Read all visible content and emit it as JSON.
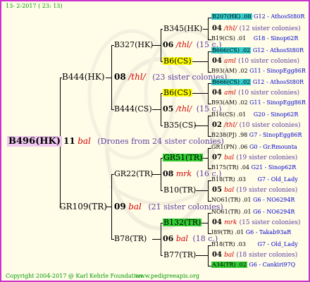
{
  "header": {
    "date": "13-  2-2017 ( 23: 13)"
  },
  "footer": {
    "copyright": "Copyright 2004-2017 @ Karl Kehrle Foundation.",
    "website": "www.pedigreeapis.org"
  },
  "root": {
    "id": "B496(HK)",
    "drones_num": "11",
    "drones_group": "bal",
    "drones_note": "(Drones from 24 sister colonies)"
  },
  "gen1": [
    "B444(HK)",
    "GR109(TR)"
  ],
  "gen1_drones": [
    {
      "num": "08",
      "group": "/thl/",
      "note": "(23 sister colonies)"
    },
    {
      "num": "09",
      "group": "bal",
      "note": "(21 sister colonies)"
    }
  ],
  "gen2": [
    "B327(HK)",
    "B444(CS)",
    "GR22(TR)",
    "B78(TR)"
  ],
  "gen2_drones": [
    {
      "num": "06",
      "group": "/thl/",
      "note": "(15 c.)"
    },
    {
      "num": "05",
      "group": "/thl/",
      "note": "(15 c.)"
    },
    {
      "num": "08",
      "group": "mrk",
      "note": "(16 c.)"
    },
    {
      "num": "06",
      "group": "bal",
      "note": "(18 c.)"
    }
  ],
  "gen3": [
    "B345(HK)",
    "B6(CS)",
    "B6(CS)",
    "B35(CS)",
    "GR51(TR)",
    "B10(TR)",
    "B132(TR)",
    "B77(TR)"
  ],
  "gen3_drones": [
    {
      "num": "04",
      "group": "/thl/",
      "note": "(12 sister colonies)"
    },
    {
      "num": "04",
      "group": "aml",
      "note": "(10 sister colonies)"
    },
    {
      "num": "04",
      "group": "aml",
      "note": "(10 sister colonies)"
    },
    {
      "num": "02",
      "group": "/thl/",
      "note": "(10 sister colonies)"
    },
    {
      "num": "07",
      "group": "bal",
      "note": "(19 sister colonies)"
    },
    {
      "num": "05",
      "group": "bal",
      "note": "(19 sister colonies)"
    },
    {
      "num": "04",
      "group": "mrk",
      "note": "(15 sister colonies)"
    },
    {
      "num": "04",
      "group": "bal",
      "note": "(18 sister colonies)"
    }
  ],
  "gen4": [
    {
      "id": "B207(HK) .08",
      "info": "G12 - AthosSt80R"
    },
    {
      "id": "B19(CS) .01",
      "info": "G18 - Sinop62R"
    },
    {
      "id": "B666(CS) .02",
      "info": "G12 - AthosSt80R"
    },
    {
      "id": "B93(AM) .02",
      "info": "G11 - SinopEgg86R"
    },
    {
      "id": "B666(CS) .02",
      "info": "G12 - AthosSt80R"
    },
    {
      "id": "B93(AM) .02",
      "info": "G11 - SinopEgg86R"
    },
    {
      "id": "B16(CS) .01",
      "info": "G20 - Sinop62R"
    },
    {
      "id": "B238(PJ) .98",
      "info": "G7 - SinopEgg86R"
    },
    {
      "id": "GR1(PN) .06",
      "info": "G0 - Gr.Rmounta"
    },
    {
      "id": "B175(TR) .04",
      "info": "G21 - Sinop62R"
    },
    {
      "id": "B18(TR) .03",
      "info": "G7 - Old_Lady"
    },
    {
      "id": "NO61(TR) .01",
      "info": "G6 - NO6294R"
    },
    {
      "id": "NO61(TR) .01",
      "info": "G6 - NO6294R"
    },
    {
      "id": "I89(TR) .01",
      "info": "G6 - Takab93aR"
    },
    {
      "id": "B18(TR) .03",
      "info": "G7 - Old_Lady"
    },
    {
      "id": "A34(TR) .02",
      "info": "G6 - Cankiri97Q"
    }
  ]
}
